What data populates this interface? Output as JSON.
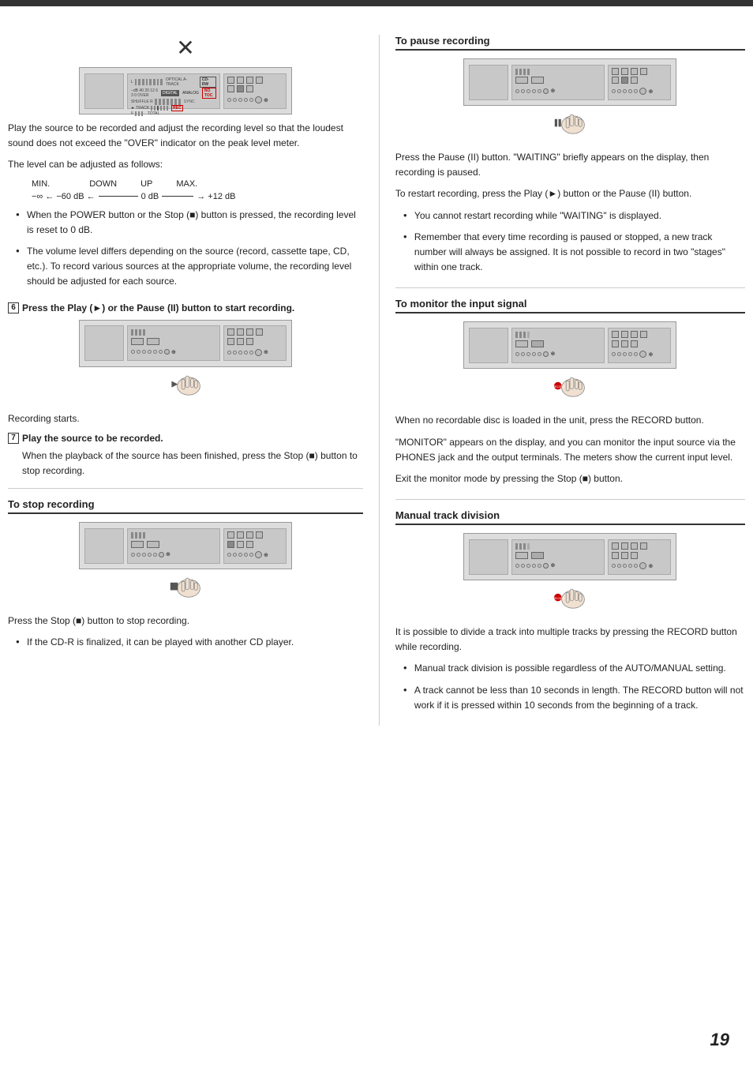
{
  "page": {
    "number": "19",
    "top_bar_visible": true
  },
  "left_col": {
    "x_icon": "✕",
    "device_label": "CD-RW device with display",
    "intro_text": "Play the source to be recorded and adjust the recording level so that the loudest sound does not exceed the \"OVER\" indicator on the peak level meter.",
    "level_intro": "The level can be adjusted as follows:",
    "level_labels": [
      "MIN.",
      "DOWN",
      "UP",
      "MAX."
    ],
    "level_scale": "−∞ ← −60 dB ←————— 0 dB ——————→ +12 dB",
    "bullets_1": [
      "When the POWER button or the Stop (■) button is pressed, the recording level is reset to 0 dB.",
      "The volume level differs depending on the source (record, cassette tape, CD, etc.). To record various sources at the appropriate volume, the recording level should be adjusted for each source."
    ],
    "step6_label": "6",
    "step6_text": "Press the Play (►) or the Pause (II) button to start recording.",
    "recording_starts": "Recording starts.",
    "step7_label": "7",
    "step7_text": "Play the source to be recorded.",
    "step7_body": "When the playback of the source has been finished, press the Stop (■) button to stop recording.",
    "stop_section": {
      "title": "To stop recording",
      "body": "Press the Stop (■) button to stop recording.",
      "bullets": [
        "If the CD-R is finalized, it can be played with another CD player."
      ]
    }
  },
  "right_col": {
    "pause_section": {
      "title": "To pause recording",
      "body1": "Press the Pause (II) button. \"WAITING\" briefly appears on the display, then recording is paused.",
      "body2": "To restart recording, press the Play (►) button or the Pause (II) button.",
      "bullets": [
        "You cannot restart recording while \"WAITING\" is displayed.",
        "Remember that every time recording is paused or stopped, a new track number will always be assigned. It is not possible to record in two \"stages\" within one track."
      ]
    },
    "monitor_section": {
      "title": "To monitor the input signal",
      "body1": "When no recordable disc is loaded in the unit, press the RECORD button.",
      "body2": "\"MONITOR\" appears on the display, and you can monitor the input source via the PHONES jack and the output terminals. The meters show the current input level.",
      "body3": "Exit the monitor mode by pressing the Stop (■) button."
    },
    "manual_track_section": {
      "title": "Manual track division",
      "body1": "It is possible to divide a track into multiple tracks by pressing the RECORD button while recording.",
      "bullets": [
        "Manual track division is possible regardless of the AUTO/MANUAL setting.",
        "A track cannot be less than 10 seconds in length. The RECORD button will not work if it is pressed within 10 seconds from the beginning of a track."
      ]
    }
  }
}
